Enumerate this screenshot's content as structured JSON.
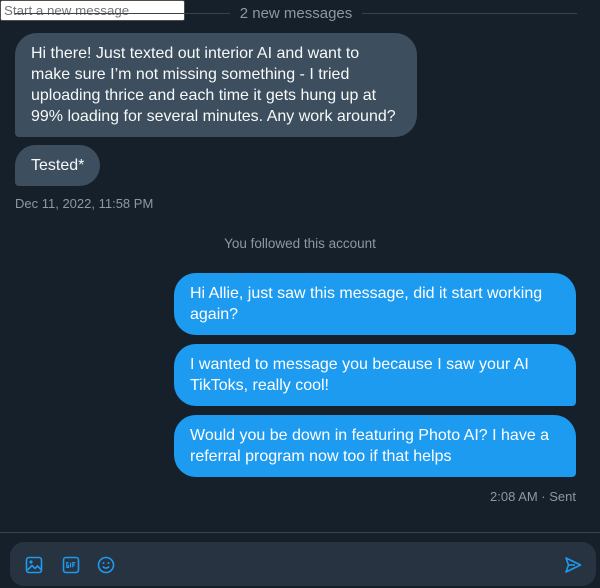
{
  "divider": {
    "label": "2 new messages"
  },
  "incoming": [
    {
      "text": "Hi there! Just texted out interior AI and want to make sure I’m not missing something - I tried uploading thrice and each time it gets hung up at 99% loading for several minutes. Any work around?"
    },
    {
      "text": "Tested*"
    }
  ],
  "incoming_timestamp": "Dec 11, 2022, 11:58 PM",
  "system_note": "You followed this account",
  "outgoing": [
    {
      "text": "Hi Allie, just saw this message, did it start working again?"
    },
    {
      "text": "I wanted to message you because I saw your AI TikToks, really cool!"
    },
    {
      "text": "Would you be down in featuring Photo AI? I have a referral program now too if that helps"
    }
  ],
  "outgoing_status": "2:08 AM · Sent",
  "composer": {
    "placeholder": "Start a new message",
    "icons": [
      "image-icon",
      "gif-icon",
      "emoji-icon",
      "send-icon"
    ]
  },
  "colors": {
    "background": "#15202b",
    "incoming_bubble": "#3d4f5e",
    "outgoing_bubble": "#1d9bf0",
    "accent": "#1d9bf0",
    "muted_text": "#8b98a5"
  }
}
